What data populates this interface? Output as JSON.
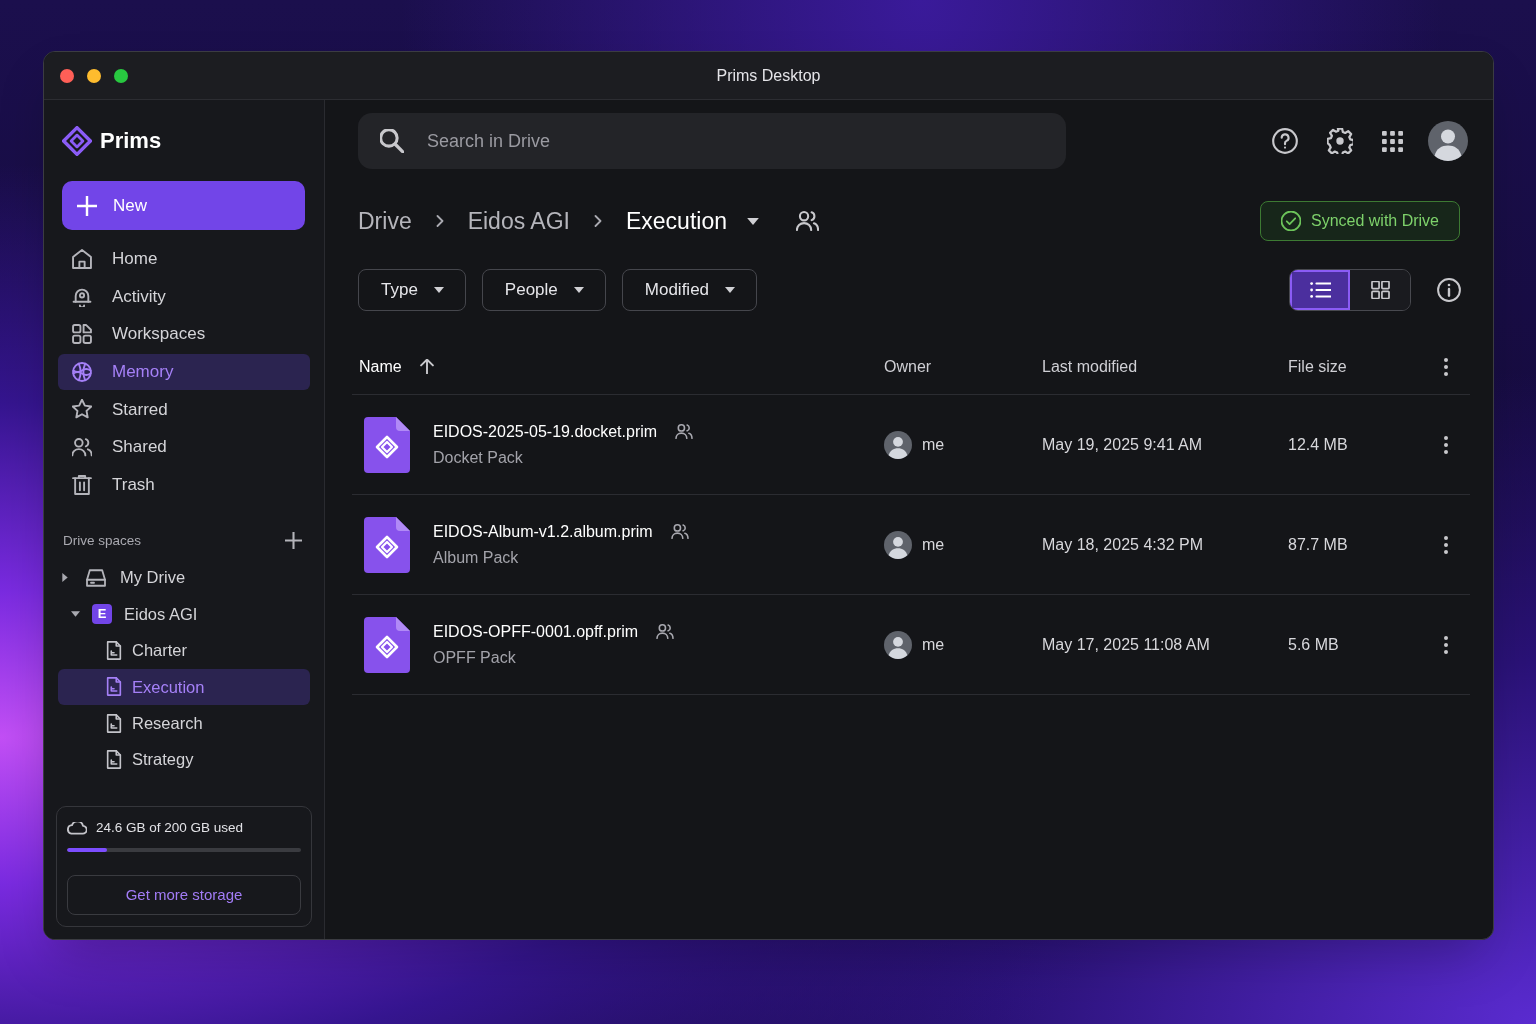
{
  "window": {
    "title": "Prims Desktop"
  },
  "sidebar": {
    "app_name": "Prims",
    "new_button": "New",
    "nav": [
      {
        "label": "Home",
        "selected": false
      },
      {
        "label": "Activity",
        "selected": false
      },
      {
        "label": "Workspaces",
        "selected": false
      },
      {
        "label": "Memory",
        "selected": true
      },
      {
        "label": "Starred",
        "selected": false
      },
      {
        "label": "Shared",
        "selected": false
      },
      {
        "label": "Trash",
        "selected": false
      }
    ],
    "drive_spaces": {
      "heading": "Drive spaces",
      "tree": [
        {
          "kind": "drive",
          "label": "My Drive",
          "expanded": false,
          "selected": false
        },
        {
          "kind": "space",
          "label": "Eidos AGI",
          "badge": "E",
          "expanded": true,
          "selected": false,
          "children": [
            {
              "kind": "doc",
              "label": "Charter",
              "selected": false
            },
            {
              "kind": "doc",
              "label": "Execution",
              "selected": true
            },
            {
              "kind": "doc",
              "label": "Research",
              "selected": false
            },
            {
              "kind": "doc",
              "label": "Strategy",
              "selected": false
            }
          ]
        }
      ]
    },
    "storage": {
      "usage": "24.6 GB of 200 GB used",
      "level": 0.17,
      "button": "Get more storage"
    }
  },
  "search": {
    "placeholder": "Search in Drive"
  },
  "breadcrumb": [
    {
      "label": "Drive",
      "selected": false
    },
    {
      "label": "Eidos AGI",
      "selected": false
    },
    {
      "label": "Execution",
      "selected": true
    }
  ],
  "sync_status": {
    "label": "Synced with Drive"
  },
  "filters": [
    {
      "label": "Type"
    },
    {
      "label": "People"
    },
    {
      "label": "Modified"
    }
  ],
  "view_modes": [
    {
      "kind": "list",
      "selected": true
    },
    {
      "kind": "grid",
      "selected": false
    }
  ],
  "table": {
    "columns": [
      {
        "label": "Name",
        "sorted": true,
        "ascending": true
      },
      {
        "label": "Owner",
        "sorted": false
      },
      {
        "label": "Last modified",
        "sorted": false
      },
      {
        "label": "File size",
        "sorted": false
      }
    ],
    "rows": [
      {
        "name": "EIDOS-2025-05-19.docket.prim",
        "shared": true,
        "type": "Docket Pack",
        "owner": "me",
        "modified": "May 19, 2025 9:41 AM",
        "size": "12.4 MB"
      },
      {
        "name": "EIDOS-Album-v1.2.album.prim",
        "shared": true,
        "type": "Album Pack",
        "owner": "me",
        "modified": "May 18, 2025 4:32 PM",
        "size": "87.7 MB"
      },
      {
        "name": "EIDOS-OPFF-0001.opff.prim",
        "shared": true,
        "type": "OPFF Pack",
        "owner": "me",
        "modified": "May 17, 2025 11:08 AM",
        "size": "5.6 MB"
      }
    ]
  }
}
